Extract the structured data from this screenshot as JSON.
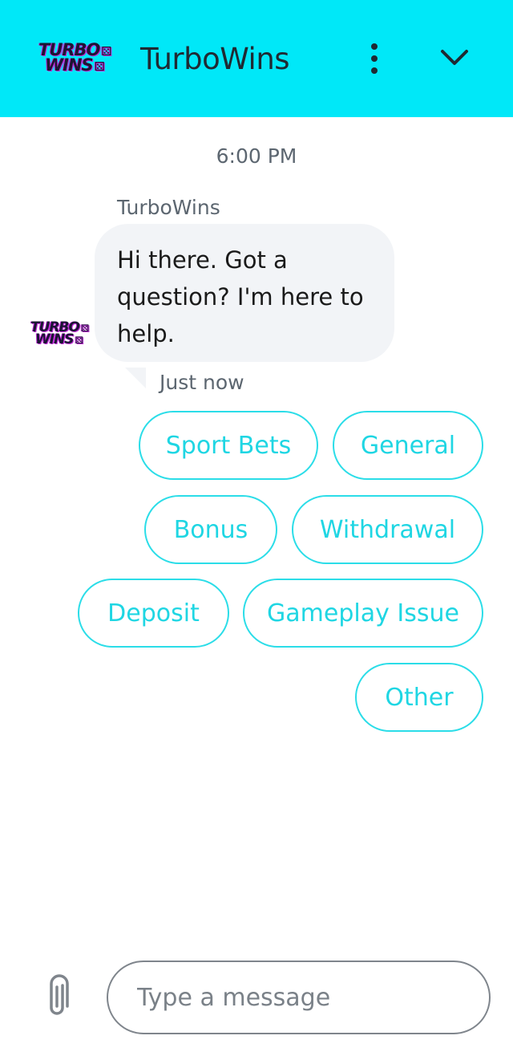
{
  "header": {
    "title": "TurboWins",
    "logo_line1": "TURBO",
    "logo_line2": "WINS",
    "menu_icon": "vertical-dots-icon",
    "collapse_icon": "chevron-down-icon"
  },
  "chat": {
    "timestamp": "6:00 PM",
    "sender": "TurboWins",
    "message": "Hi there. Got a question? I'm here to help.",
    "status": "Just now",
    "avatar_line1": "TURBO",
    "avatar_line2": "WINS"
  },
  "quick_replies": [
    "Sport Bets",
    "General",
    "Bonus",
    "Withdrawal",
    "Deposit",
    "Gameplay Issue",
    "Other"
  ],
  "composer": {
    "placeholder": "Type a message",
    "attach_icon": "paperclip-icon"
  },
  "colors": {
    "header_bg": "#00e8f8",
    "accent": "#1fd6e3",
    "bubble_bg": "#f2f4f7",
    "logo_dark": "#1b1533",
    "logo_glow": "#c02bd8"
  }
}
